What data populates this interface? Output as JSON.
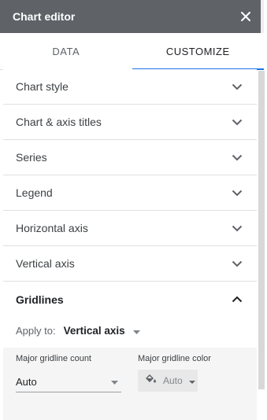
{
  "header": {
    "title": "Chart editor",
    "close_icon": "close-icon"
  },
  "tabs": [
    {
      "label": "DATA",
      "active": false
    },
    {
      "label": "CUSTOMIZE",
      "active": true
    }
  ],
  "sections": [
    {
      "label": "Chart style",
      "expanded": false
    },
    {
      "label": "Chart & axis titles",
      "expanded": false
    },
    {
      "label": "Series",
      "expanded": false
    },
    {
      "label": "Legend",
      "expanded": false
    },
    {
      "label": "Horizontal axis",
      "expanded": false
    },
    {
      "label": "Vertical axis",
      "expanded": false
    },
    {
      "label": "Gridlines",
      "expanded": true
    }
  ],
  "gridlines": {
    "apply_to_label": "Apply to:",
    "apply_to_value": "Vertical axis",
    "major_count_label": "Major gridline count",
    "major_count_value": "Auto",
    "major_color_label": "Major gridline color",
    "major_color_value": "Auto"
  },
  "colors": {
    "header_bg": "#5f6368",
    "active_tab_underline": "#1a73e8"
  }
}
